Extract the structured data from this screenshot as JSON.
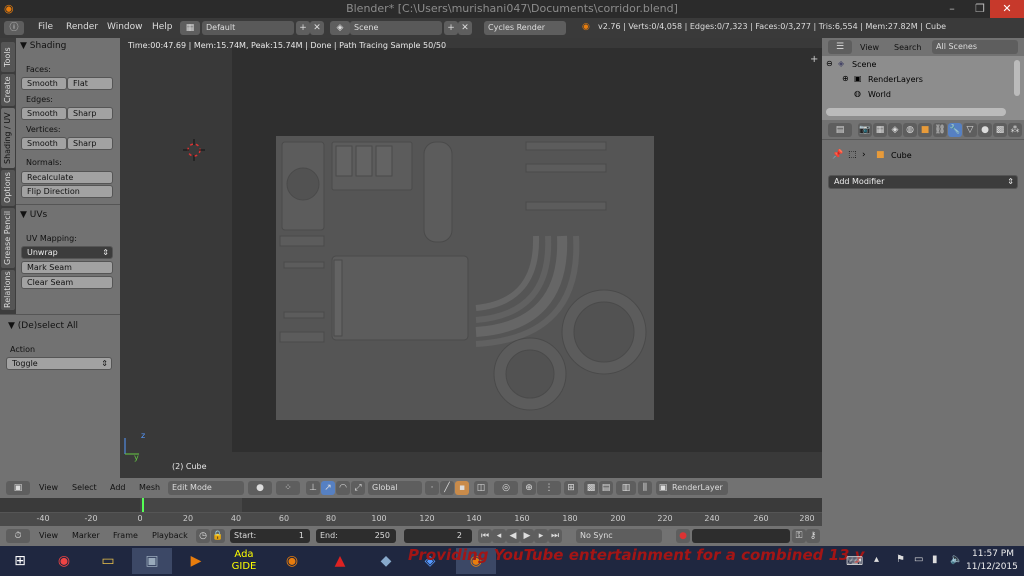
{
  "window": {
    "title": "Blender* [C:\\Users\\murishani047\\Documents\\corridor.blend]"
  },
  "menubar": {
    "items": [
      "File",
      "Render",
      "Window",
      "Help"
    ],
    "screen_layout": "Default",
    "scene": "Scene",
    "render_engine": "Cycles Render",
    "stats": "v2.76 | Verts:0/4,058 | Edges:0/7,323 | Faces:0/3,277 | Tris:6,554 | Mem:27.82M | Cube"
  },
  "tabs": [
    "Tools",
    "Create",
    "Shading / UV",
    "Options",
    "Grease Pencil",
    "Relations"
  ],
  "toolshelf": {
    "shading": {
      "header": "Shading",
      "faces_label": "Faces:",
      "faces_buttons": [
        "Smooth",
        "Flat"
      ],
      "edges_label": "Edges:",
      "edges_buttons": [
        "Smooth",
        "Sharp"
      ],
      "vertices_label": "Vertices:",
      "vertices_buttons": [
        "Smooth",
        "Sharp"
      ],
      "normals_label": "Normals:",
      "recalculate": "Recalculate",
      "flip_direction": "Flip Direction"
    },
    "uvs": {
      "header": "UVs",
      "mapping_label": "UV Mapping:",
      "unwrap": "Unwrap",
      "mark_seam": "Mark Seam",
      "clear_seam": "Clear Seam"
    },
    "operator": {
      "header": "(De)select All",
      "action_label": "Action",
      "action_value": "Toggle"
    }
  },
  "viewport": {
    "info": "Time:00:47.69 | Mem:15.74M, Peak:15.74M | Done | Path Tracing Sample 50/50",
    "object_label": "(2) Cube",
    "axis_z": "z",
    "axis_y": "y"
  },
  "header3d": {
    "menus": [
      "View",
      "Select",
      "Add",
      "Mesh"
    ],
    "mode": "Edit Mode",
    "orientation": "Global",
    "render_layer": "RenderLayer"
  },
  "timeline": {
    "ticks": [
      "-40",
      "-20",
      "0",
      "20",
      "40",
      "60",
      "80",
      "100",
      "120",
      "140",
      "160",
      "180",
      "200",
      "220",
      "240",
      "260",
      "280"
    ]
  },
  "timeline_header": {
    "menus": [
      "View",
      "Marker",
      "Frame",
      "Playback"
    ],
    "start": "Start:",
    "start_value": "1",
    "end": "End:",
    "end_value": "250",
    "current_frame": "2",
    "sync": "No Sync"
  },
  "outliner": {
    "view": "View",
    "search": "Search",
    "filter": "All Scenes",
    "items": [
      "Scene",
      "RenderLayers",
      "World"
    ]
  },
  "properties": {
    "object": "Cube",
    "add_modifier": "Add Modifier"
  },
  "taskbar": {
    "time": "11:57 PM",
    "date": "11/12/2015",
    "watermark": "Providing YouTube entertainment for a combined 13 y"
  }
}
